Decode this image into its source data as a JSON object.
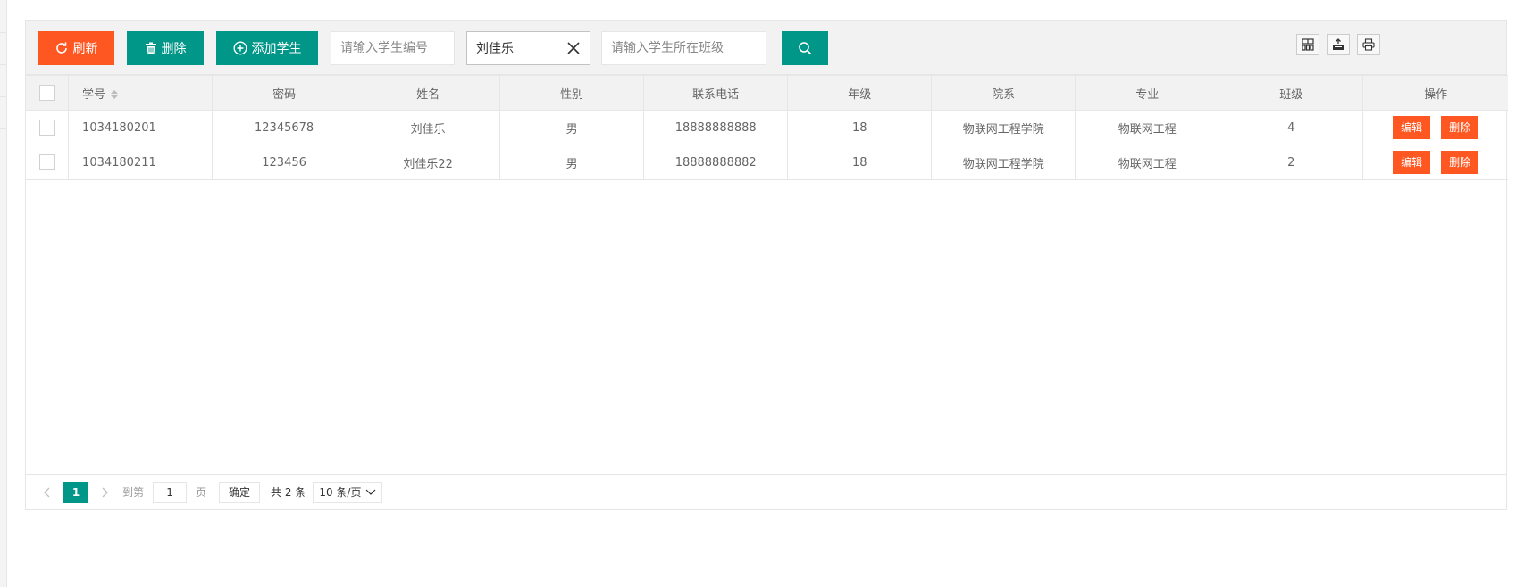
{
  "toolbar": {
    "refresh_label": "刷新",
    "delete_label": "删除",
    "add_label": "添加学生",
    "search_id_placeholder": "请输入学生编号",
    "search_name_value": "刘佳乐",
    "search_class_placeholder": "请输入学生所在班级"
  },
  "table": {
    "headers": [
      "学号",
      "密码",
      "姓名",
      "性别",
      "联系电话",
      "年级",
      "院系",
      "专业",
      "班级",
      "操作"
    ],
    "rows": [
      {
        "id": "1034180201",
        "password": "12345678",
        "name": "刘佳乐",
        "gender": "男",
        "phone": "18888888888",
        "grade": "18",
        "college": "物联网工程学院",
        "major": "物联网工程",
        "class": "4",
        "edit": "编辑",
        "delete": "删除"
      },
      {
        "id": "1034180211",
        "password": "123456",
        "name": "刘佳乐22",
        "gender": "男",
        "phone": "18888888882",
        "grade": "18",
        "college": "物联网工程学院",
        "major": "物联网工程",
        "class": "2",
        "edit": "编辑",
        "delete": "删除"
      }
    ]
  },
  "pager": {
    "current_page": "1",
    "goto_label": "到第",
    "page_input": "1",
    "page_suffix": "页",
    "confirm_label": "确定",
    "total_label": "共 2 条",
    "page_size": "10 条/页"
  },
  "colors": {
    "orange": "#FF5722",
    "teal": "#009688"
  }
}
